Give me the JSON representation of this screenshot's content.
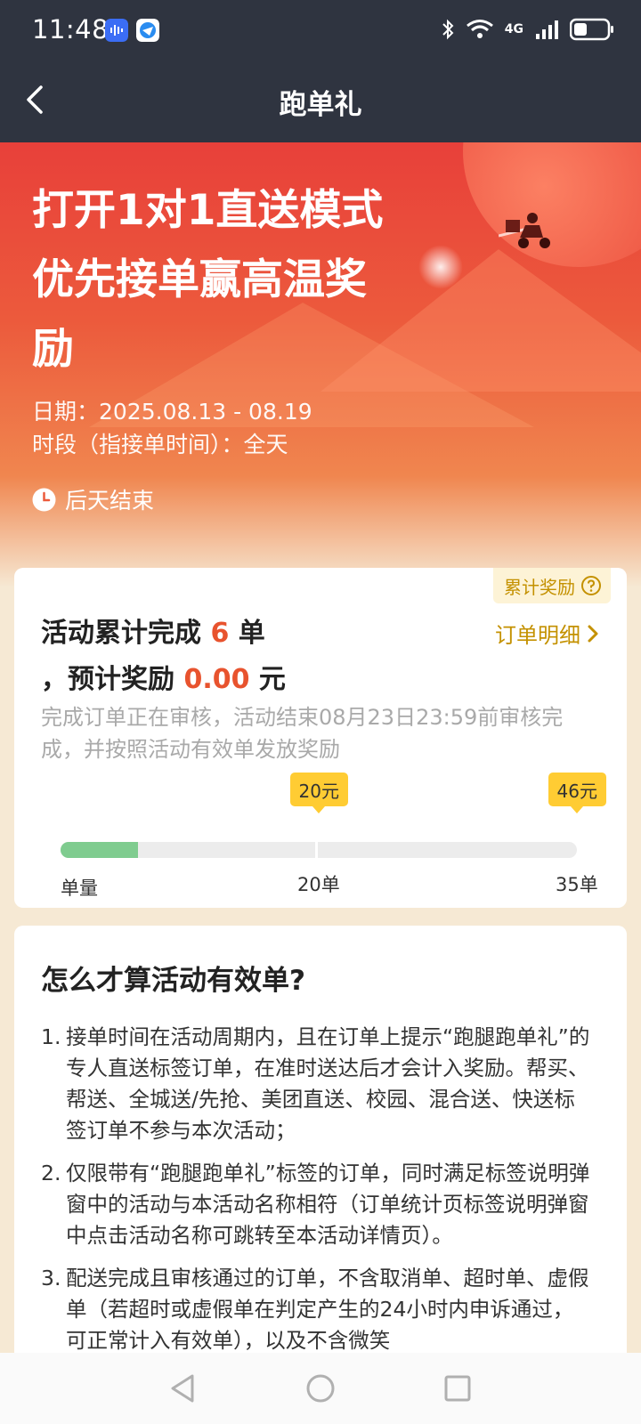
{
  "status_bar": {
    "time": "11:48",
    "network_label": "4G"
  },
  "nav": {
    "title": "跑单礼",
    "back_icon": "chevron-left-icon"
  },
  "hero": {
    "headline_lines": [
      "打开1对1直送模式",
      "优先接单赢高温奖",
      "励"
    ],
    "date": "日期：2025.08.13 - 08.19",
    "period": "时段（指接单时间）：全天",
    "ends": "后天结束"
  },
  "summary": {
    "reward_tag": "累计奖励",
    "line1_prefix": "活动累计完成 ",
    "order_count": "6",
    "line1_suffix": " 单",
    "line2_prefix": "，预计奖励 ",
    "reward_amount": "0.00",
    "line2_suffix": " 元",
    "order_detail_link": "订单明细",
    "note": "完成订单正在审核，活动结束08月23日23:59前审核完成，并按照活动有效单发放奖励",
    "progress": {
      "completed": 6,
      "max": 35,
      "milestones": [
        {
          "orders": 20,
          "bubble": "20元",
          "label": "20单"
        },
        {
          "orders": 35,
          "bubble": "46元",
          "label": "35单"
        }
      ],
      "start_label": "单量"
    }
  },
  "rules": {
    "title": "怎么才算活动有效单?",
    "items": [
      {
        "num": "1.",
        "text": "接单时间在活动周期内，且在订单上提示“跑腿跑单礼”的专人直送标签订单，在准时送达后才会计入奖励。帮买、帮送、全城送/先抢、美团直送、校园、混合送、快送标签订单不参与本次活动；"
      },
      {
        "num": "2.",
        "text": "仅限带有“跑腿跑单礼”标签的订单，同时满足标签说明弹窗中的活动与本活动名称相符（订单统计页标签说明弹窗中点击活动名称可跳转至本活动详情页）。"
      },
      {
        "num": "3.",
        "text": "配送完成且审核通过的订单，不含取消单、超时单、虚假单（若超时或虚假单在判定产生的24小时内申诉通过，可正常计入有效单），以及不含微笑"
      }
    ]
  },
  "colors": {
    "header_bg": "#2f3440",
    "hero_red": "#e8403a",
    "highlight": "#e8532e",
    "gold": "#c49100",
    "progress_fill": "#7fcc8f",
    "bubble": "#ffcc33"
  }
}
